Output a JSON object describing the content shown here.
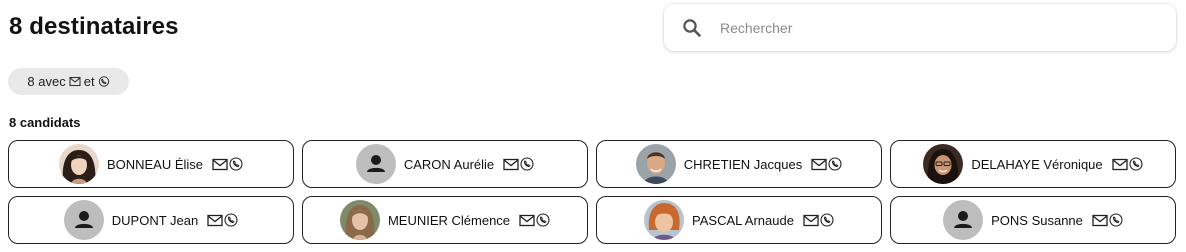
{
  "header": {
    "title": "8 destinataires"
  },
  "search": {
    "placeholder": "Rechercher",
    "value": ""
  },
  "filter_chip": {
    "count_label": "8 avec",
    "and_label": "et"
  },
  "candidates": {
    "heading": "8 candidats",
    "items": [
      {
        "name": "BONNEAU Élise",
        "avatar": "photo-asian-woman-dark-hair"
      },
      {
        "name": "CARON Aurélie",
        "avatar": "placeholder-person"
      },
      {
        "name": "CHRETIEN Jacques",
        "avatar": "photo-man-short-hair"
      },
      {
        "name": "DELAHAYE Véronique",
        "avatar": "photo-woman-glasses"
      },
      {
        "name": "DUPONT Jean",
        "avatar": "placeholder-person"
      },
      {
        "name": "MEUNIER Clémence",
        "avatar": "photo-woman-long-light-hair"
      },
      {
        "name": "PASCAL Arnaude",
        "avatar": "photo-woman-red-short-hair"
      },
      {
        "name": "PONS Susanne",
        "avatar": "placeholder-person"
      }
    ]
  },
  "icons": {
    "search": "search-icon",
    "email": "envelope-icon",
    "phone": "phone-icon"
  },
  "colors": {
    "chip_bg": "#e9e9e9",
    "card_border": "#222222",
    "placeholder_avatar_bg": "#bdbdbd"
  }
}
